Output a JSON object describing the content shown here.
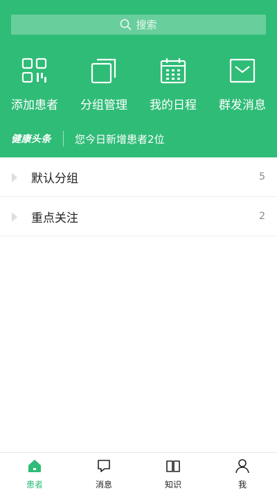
{
  "colors": {
    "brand": "#2fbc77",
    "text": "#222222",
    "muted": "#888888",
    "white": "#ffffff"
  },
  "search": {
    "placeholder": "搜索",
    "icon": "search-icon"
  },
  "quick_actions": [
    {
      "label": "添加患者",
      "icon": "qr-code-icon"
    },
    {
      "label": "分组管理",
      "icon": "copy-squares-icon"
    },
    {
      "label": "我的日程",
      "icon": "calendar-icon"
    },
    {
      "label": "群发消息",
      "icon": "envelope-icon"
    }
  ],
  "news": {
    "brand": "健康头条",
    "text": "您今日新增患者2位"
  },
  "groups": [
    {
      "name": "默认分组",
      "count": "5"
    },
    {
      "name": "重点关注",
      "count": "2"
    }
  ],
  "tabbar": {
    "items": [
      {
        "label": "患者",
        "icon": "home-icon",
        "active": true
      },
      {
        "label": "消息",
        "icon": "chat-bubble-icon",
        "active": false
      },
      {
        "label": "知识",
        "icon": "book-icon",
        "active": false
      },
      {
        "label": "我",
        "icon": "person-icon",
        "active": false
      }
    ]
  }
}
